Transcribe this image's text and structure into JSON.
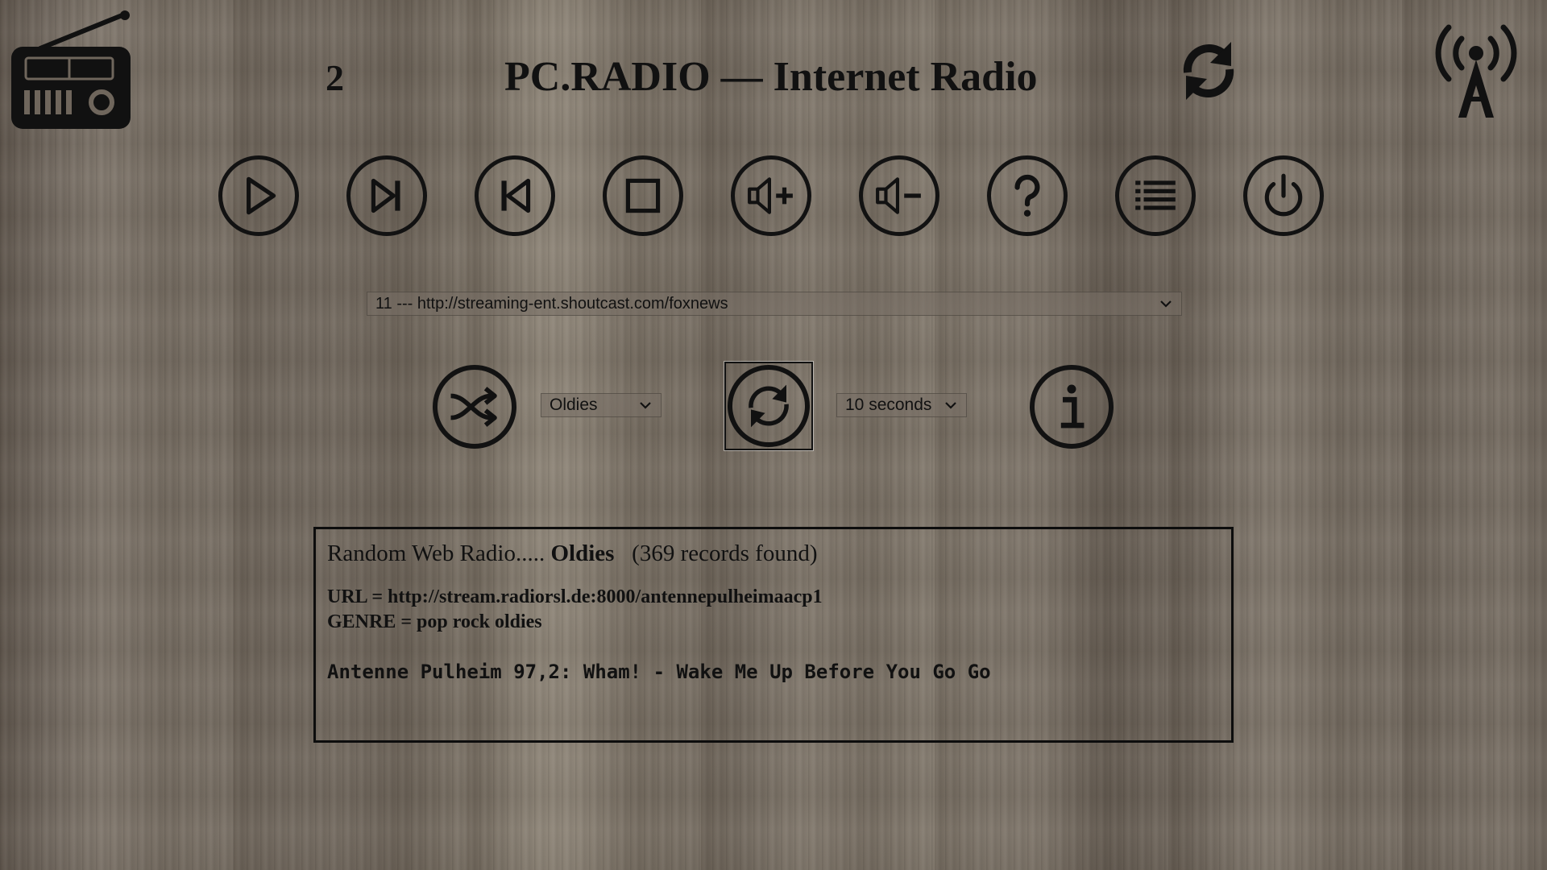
{
  "header": {
    "counter": "2",
    "title": "PC.RADIO — Internet Radio",
    "logo_icon": "radio-icon",
    "refresh_icon": "refresh-icon",
    "antenna_icon": "broadcast-antenna-icon"
  },
  "controls": [
    {
      "name": "play-button",
      "icon": "play-icon"
    },
    {
      "name": "next-button",
      "icon": "skip-next-icon"
    },
    {
      "name": "previous-button",
      "icon": "skip-previous-icon"
    },
    {
      "name": "stop-button",
      "icon": "stop-icon"
    },
    {
      "name": "volume-up-button",
      "icon": "volume-up-icon"
    },
    {
      "name": "volume-down-button",
      "icon": "volume-down-icon"
    },
    {
      "name": "help-button",
      "icon": "help-icon"
    },
    {
      "name": "list-button",
      "icon": "list-icon"
    },
    {
      "name": "power-button",
      "icon": "power-icon"
    }
  ],
  "station_select": {
    "selected": "11 --- http://streaming-ent.shoutcast.com/foxnews"
  },
  "random": {
    "shuffle_icon": "shuffle-icon",
    "genre_selected": "Oldies",
    "auto_refresh_icon": "auto-refresh-icon",
    "interval_selected": "10 seconds",
    "info_icon": "info-icon"
  },
  "info": {
    "prefix": "Random Web Radio.....",
    "genre": "Oldies",
    "records": "(369 records found)",
    "url_line": "URL = http://stream.radiorsl.de:8000/antennepulheimaacp1",
    "genre_line": "GENRE = pop rock oldies",
    "now_playing": "Antenne Pulheim 97,2: Wham! - Wake Me Up Before You Go Go"
  }
}
